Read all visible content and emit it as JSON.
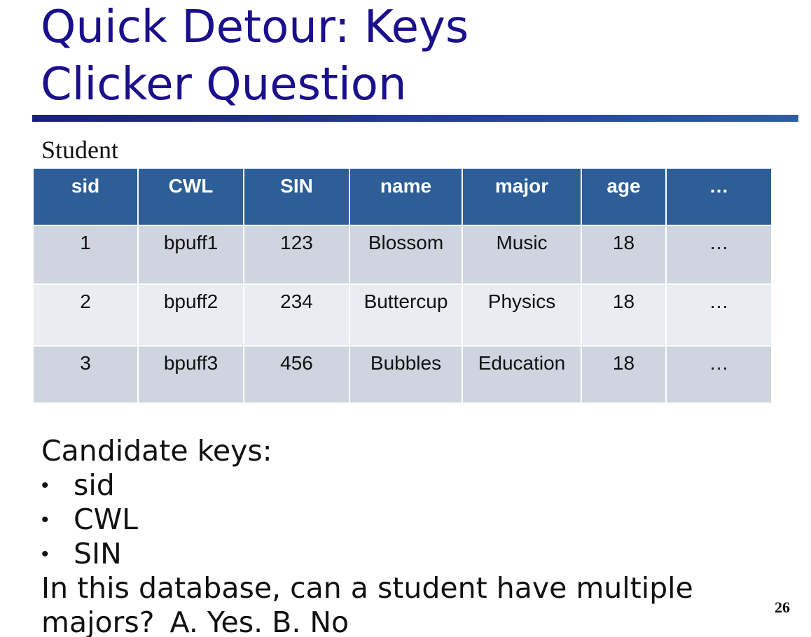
{
  "slide": {
    "title_line1": "Quick Detour: Keys",
    "title_line2": "Clicker Question",
    "page_number": "26"
  },
  "table": {
    "caption": "Student",
    "headers": [
      "sid",
      "CWL",
      "SIN",
      "name",
      "major",
      "age",
      "…"
    ],
    "rows": [
      [
        "1",
        "bpuff1",
        "123",
        "Blossom",
        "Music",
        "18",
        "…"
      ],
      [
        "2",
        "bpuff2",
        "234",
        "Buttercup",
        "Physics",
        "18",
        "…"
      ],
      [
        "3",
        "bpuff3",
        "456",
        "Bubbles",
        "Education",
        "18",
        "…"
      ]
    ]
  },
  "body": {
    "candidate_label": "Candidate keys:",
    "bullet_symbol": "•",
    "keys": [
      "sid",
      "CWL",
      "SIN"
    ],
    "question": "In this database, can a student have multiple majors?",
    "answer_a": "A. Yes.",
    "answer_b": "B. No"
  },
  "colors": {
    "title": "#1a0f8c",
    "header_fill": "#2d5e97",
    "row_dark": "#cfd5df",
    "row_light": "#e9ecf1"
  }
}
